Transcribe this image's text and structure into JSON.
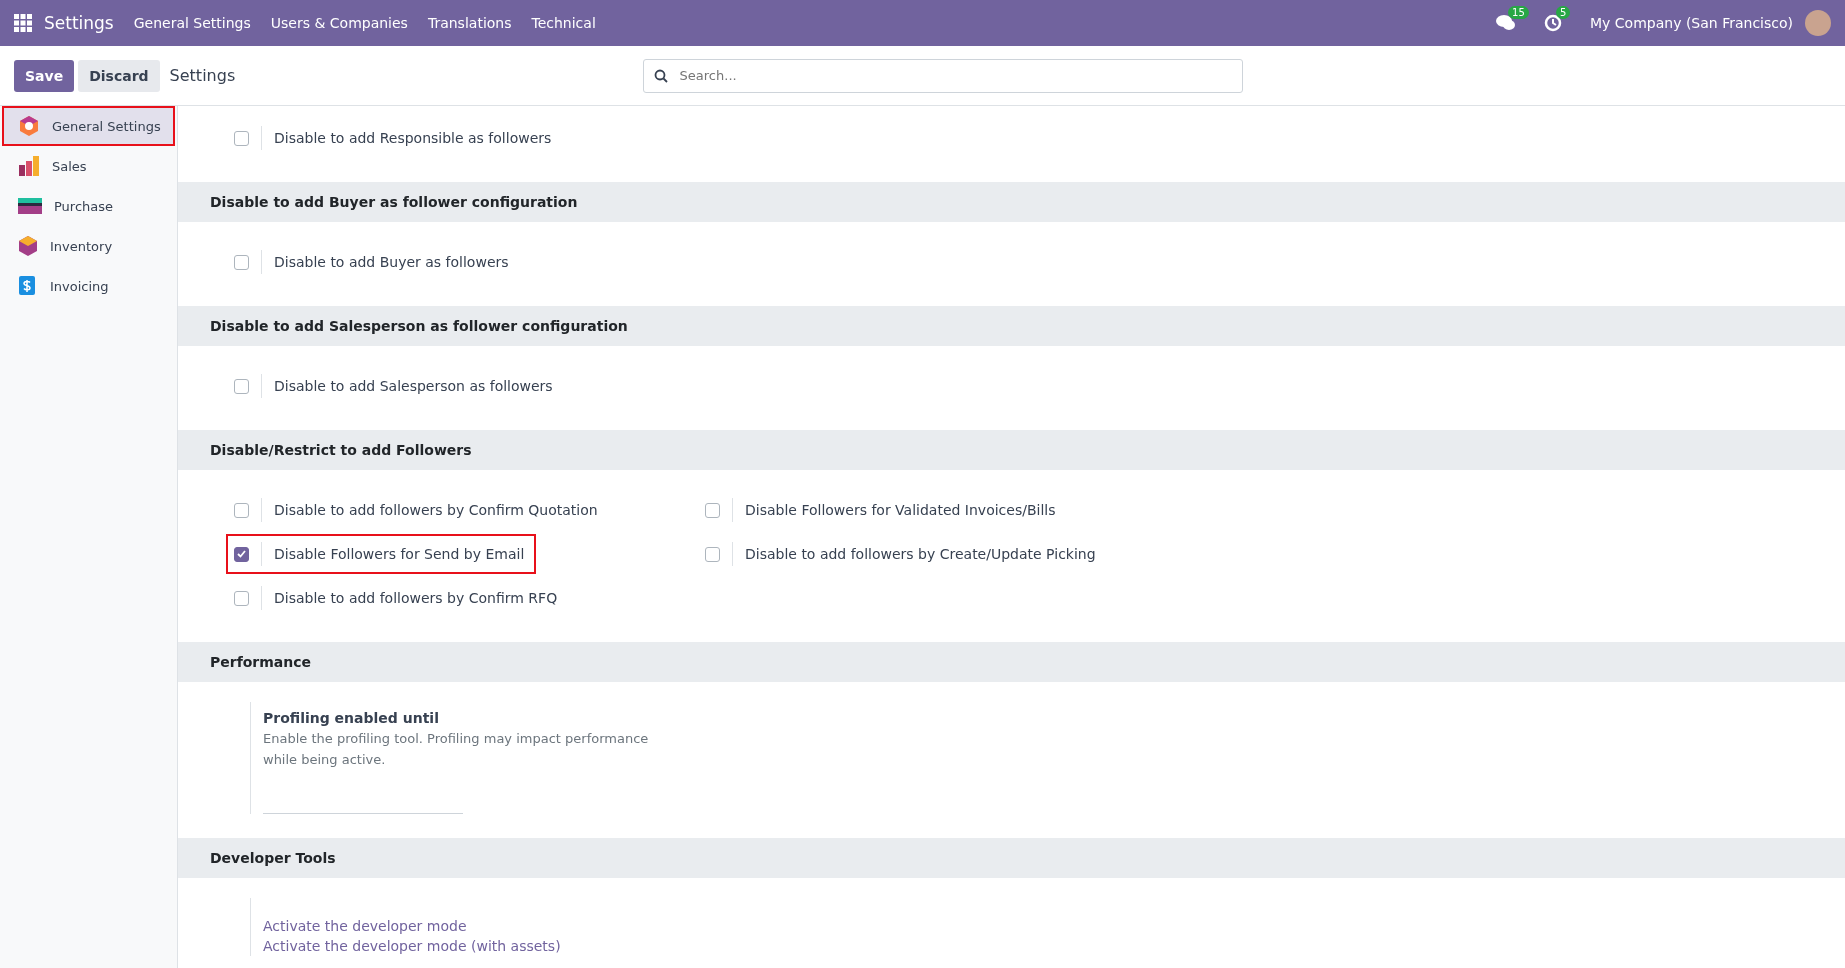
{
  "navbar": {
    "app": "Settings",
    "menu": [
      "General Settings",
      "Users & Companies",
      "Translations",
      "Technical"
    ],
    "messages_count": "15",
    "activities_count": "5",
    "company": "My Company (San Francisco)"
  },
  "control_panel": {
    "save": "Save",
    "discard": "Discard",
    "title": "Settings",
    "search": {
      "placeholder": "Search..."
    }
  },
  "sidebar": {
    "items": [
      {
        "label": "General Settings",
        "selected": true,
        "highlighted": true,
        "kind": "general"
      },
      {
        "label": "Sales",
        "selected": false,
        "highlighted": false,
        "kind": "sales"
      },
      {
        "label": "Purchase",
        "selected": false,
        "highlighted": false,
        "kind": "purchase"
      },
      {
        "label": "Inventory",
        "selected": false,
        "highlighted": false,
        "kind": "inventory"
      },
      {
        "label": "Invoicing",
        "selected": false,
        "highlighted": false,
        "kind": "invoicing"
      }
    ]
  },
  "sections": [
    {
      "items": [
        {
          "kind": "checkbox",
          "label": "Disable to add Responsible as followers",
          "checked": false,
          "highlighted": false
        }
      ]
    },
    {
      "title": "Disable to add Buyer as follower configuration",
      "items": [
        {
          "kind": "checkbox",
          "label": "Disable to add Buyer as followers",
          "checked": false,
          "highlighted": false
        }
      ]
    },
    {
      "title": "Disable to add Salesperson as follower configuration",
      "items": [
        {
          "kind": "checkbox",
          "label": "Disable to add Salesperson as followers",
          "checked": false,
          "highlighted": false
        }
      ]
    },
    {
      "title": "Disable/Restrict to add Followers",
      "items": [
        {
          "kind": "checkbox",
          "label": "Disable to add followers by Confirm Quotation",
          "checked": false,
          "highlighted": false
        },
        {
          "kind": "checkbox",
          "label": "Disable Followers for Validated Invoices/Bills",
          "checked": false,
          "highlighted": false
        },
        {
          "kind": "checkbox",
          "label": "Disable Followers for Send by Email",
          "checked": true,
          "highlighted": true
        },
        {
          "kind": "checkbox",
          "label": "Disable to add followers by Create/Update Picking",
          "checked": false,
          "highlighted": false
        },
        {
          "kind": "checkbox",
          "label": "Disable to add followers by Confirm RFQ",
          "checked": false,
          "highlighted": false
        }
      ]
    },
    {
      "title": "Performance",
      "items": [
        {
          "kind": "field",
          "label": "Profiling enabled until",
          "help": "Enable the profiling tool. Profiling may impact performance while being active."
        }
      ]
    },
    {
      "title": "Developer Tools",
      "items": [
        {
          "kind": "links",
          "links": [
            "Activate the developer mode",
            "Activate the developer mode (with assets)"
          ]
        }
      ]
    }
  ]
}
